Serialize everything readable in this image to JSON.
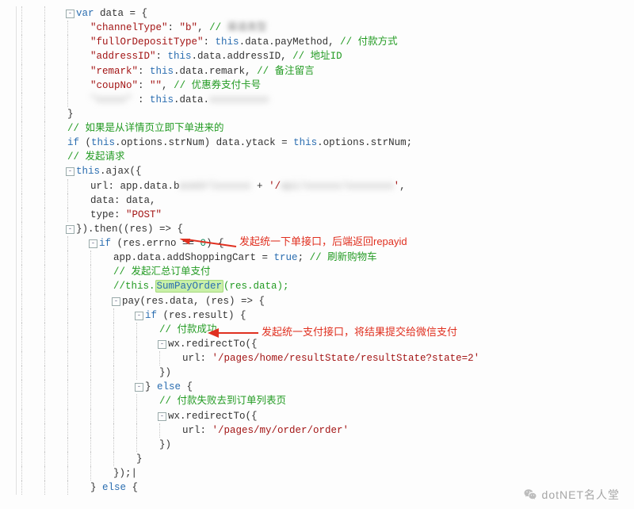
{
  "code": {
    "lines": [
      {
        "indent": 2,
        "frag": [
          {
            "t": "var ",
            "c": "kw"
          },
          {
            "t": "data = {",
            "c": "op"
          }
        ]
      },
      {
        "indent": 3,
        "frag": [
          {
            "t": "\"channelType\"",
            "c": "str"
          },
          {
            "t": ": ",
            "c": "op"
          },
          {
            "t": "\"b\"",
            "c": "str"
          },
          {
            "t": ", ",
            "c": "op"
          },
          {
            "t": "// ",
            "c": "cmt"
          },
          {
            "t": "渠道类型",
            "c": "blur cmt"
          }
        ]
      },
      {
        "indent": 3,
        "frag": [
          {
            "t": "\"fullOrDepositType\"",
            "c": "str"
          },
          {
            "t": ": ",
            "c": "op"
          },
          {
            "t": "this",
            "c": "kw"
          },
          {
            "t": ".data.payMethod, ",
            "c": "op"
          },
          {
            "t": "// 付款方式",
            "c": "cmt"
          }
        ]
      },
      {
        "indent": 3,
        "frag": [
          {
            "t": "\"addressID\"",
            "c": "str"
          },
          {
            "t": ": ",
            "c": "op"
          },
          {
            "t": "this",
            "c": "kw"
          },
          {
            "t": ".data.addressID, ",
            "c": "op"
          },
          {
            "t": "// 地址ID",
            "c": "cmt"
          }
        ]
      },
      {
        "indent": 3,
        "frag": [
          {
            "t": "\"remark\"",
            "c": "str"
          },
          {
            "t": ": ",
            "c": "op"
          },
          {
            "t": "this",
            "c": "kw"
          },
          {
            "t": ".data.remark, ",
            "c": "op"
          },
          {
            "t": "// 备注留言",
            "c": "cmt"
          }
        ]
      },
      {
        "indent": 3,
        "frag": [
          {
            "t": "\"coupNo\"",
            "c": "str"
          },
          {
            "t": ": ",
            "c": "op"
          },
          {
            "t": "\"\"",
            "c": "str"
          },
          {
            "t": ", ",
            "c": "op"
          },
          {
            "t": "// 优惠券支付卡号",
            "c": "cmt"
          }
        ]
      },
      {
        "indent": 3,
        "frag": [
          {
            "t": "\"xxxxx\"",
            "c": "blur2 str"
          },
          {
            "t": " : ",
            "c": "op"
          },
          {
            "t": "this",
            "c": "kw"
          },
          {
            "t": ".data.",
            "c": "op"
          },
          {
            "t": "xxxxxxxxxx",
            "c": "blur2 op"
          }
        ]
      },
      {
        "indent": 2,
        "frag": [
          {
            "t": "}",
            "c": "op"
          }
        ]
      },
      {
        "indent": 2,
        "frag": [
          {
            "t": "",
            "c": "op"
          }
        ]
      },
      {
        "indent": 2,
        "frag": [
          {
            "t": "// 如果是从详情页立即下单进来的",
            "c": "cmt"
          }
        ]
      },
      {
        "indent": 2,
        "frag": [
          {
            "t": "if",
            "c": "kw"
          },
          {
            "t": " (",
            "c": "op"
          },
          {
            "t": "this",
            "c": "kw"
          },
          {
            "t": ".options.strNum) data.ytack = ",
            "c": "op"
          },
          {
            "t": "this",
            "c": "kw"
          },
          {
            "t": ".options.strNum;",
            "c": "op"
          }
        ]
      },
      {
        "indent": 2,
        "frag": [
          {
            "t": "",
            "c": "op"
          }
        ]
      },
      {
        "indent": 2,
        "frag": [
          {
            "t": "// 发起请求",
            "c": "cmt"
          }
        ]
      },
      {
        "indent": 2,
        "frag": [
          {
            "t": "this",
            "c": "kw"
          },
          {
            "t": ".ajax({",
            "c": "op"
          }
        ]
      },
      {
        "indent": 3,
        "frag": [
          {
            "t": "url: app.data.b",
            "c": "op"
          },
          {
            "t": "aseUrlxxxxxx",
            "c": "blur2 op"
          },
          {
            "t": " + ",
            "c": "op"
          },
          {
            "t": "'/",
            "c": "str"
          },
          {
            "t": "api/xxxxxx/xxxxxxxx",
            "c": "blur2 str"
          },
          {
            "t": "'",
            "c": "str"
          },
          {
            "t": ",",
            "c": "op"
          }
        ]
      },
      {
        "indent": 3,
        "frag": [
          {
            "t": "data: data,",
            "c": "op"
          }
        ]
      },
      {
        "indent": 3,
        "frag": [
          {
            "t": "type: ",
            "c": "op"
          },
          {
            "t": "\"POST\"",
            "c": "str"
          }
        ]
      },
      {
        "indent": 2,
        "frag": [
          {
            "t": "}).then((res) => {",
            "c": "op"
          }
        ]
      },
      {
        "indent": 3,
        "frag": [
          {
            "t": "if",
            "c": "kw"
          },
          {
            "t": " (res.errno == ",
            "c": "op"
          },
          {
            "t": "0",
            "c": "num"
          },
          {
            "t": ") {",
            "c": "op"
          }
        ]
      },
      {
        "indent": 4,
        "frag": [
          {
            "t": "app.data.addShoppingCart = ",
            "c": "op"
          },
          {
            "t": "true",
            "c": "kw"
          },
          {
            "t": "; ",
            "c": "op"
          },
          {
            "t": "// 刷新购物车",
            "c": "cmt"
          }
        ]
      },
      {
        "indent": 4,
        "frag": [
          {
            "t": "// 发起汇总订单支付",
            "c": "cmt"
          }
        ]
      },
      {
        "indent": 4,
        "frag": [
          {
            "t": "//this.",
            "c": "cmt"
          },
          {
            "t": "SumPayOrder",
            "c": "hl"
          },
          {
            "t": "(res.data);",
            "c": "cmt"
          }
        ]
      },
      {
        "indent": 4,
        "frag": [
          {
            "t": "pay(res.data, (res) => {",
            "c": "op"
          }
        ]
      },
      {
        "indent": 5,
        "frag": [
          {
            "t": "if",
            "c": "kw"
          },
          {
            "t": " (res.result) {",
            "c": "op"
          }
        ]
      },
      {
        "indent": 6,
        "frag": [
          {
            "t": "// 付款成功",
            "c": "cmt"
          }
        ]
      },
      {
        "indent": 6,
        "frag": [
          {
            "t": "wx.redirectTo({",
            "c": "op"
          }
        ]
      },
      {
        "indent": 7,
        "frag": [
          {
            "t": "url: ",
            "c": "op"
          },
          {
            "t": "'/pages/home/resultState/resultState?state=2'",
            "c": "str"
          }
        ]
      },
      {
        "indent": 6,
        "frag": [
          {
            "t": "})",
            "c": "op"
          }
        ]
      },
      {
        "indent": 5,
        "frag": [
          {
            "t": "} ",
            "c": "op"
          },
          {
            "t": "else",
            "c": "kw"
          },
          {
            "t": " {",
            "c": "op"
          }
        ]
      },
      {
        "indent": 6,
        "frag": [
          {
            "t": "// 付款失败去到订单列表页",
            "c": "cmt"
          }
        ]
      },
      {
        "indent": 6,
        "frag": [
          {
            "t": "wx.redirectTo({",
            "c": "op"
          }
        ]
      },
      {
        "indent": 7,
        "frag": [
          {
            "t": "url: ",
            "c": "op"
          },
          {
            "t": "'/pages/my/order/order'",
            "c": "str"
          }
        ]
      },
      {
        "indent": 6,
        "frag": [
          {
            "t": "})",
            "c": "op"
          }
        ]
      },
      {
        "indent": 5,
        "frag": [
          {
            "t": "}",
            "c": "op"
          }
        ]
      },
      {
        "indent": 4,
        "frag": [
          {
            "t": "});|",
            "c": "op"
          }
        ]
      },
      {
        "indent": 3,
        "frag": [
          {
            "t": "} ",
            "c": "op"
          },
          {
            "t": "else",
            "c": "kw"
          },
          {
            "t": " {",
            "c": "op"
          }
        ]
      }
    ]
  },
  "annotations": {
    "note1": "发起统一下单接口，后端返回repayid",
    "note2": "发起统一支付接口，将结果提交给微信支付"
  },
  "watermark": {
    "text": "dotNET名人堂"
  },
  "arrow_color": "#e03020"
}
